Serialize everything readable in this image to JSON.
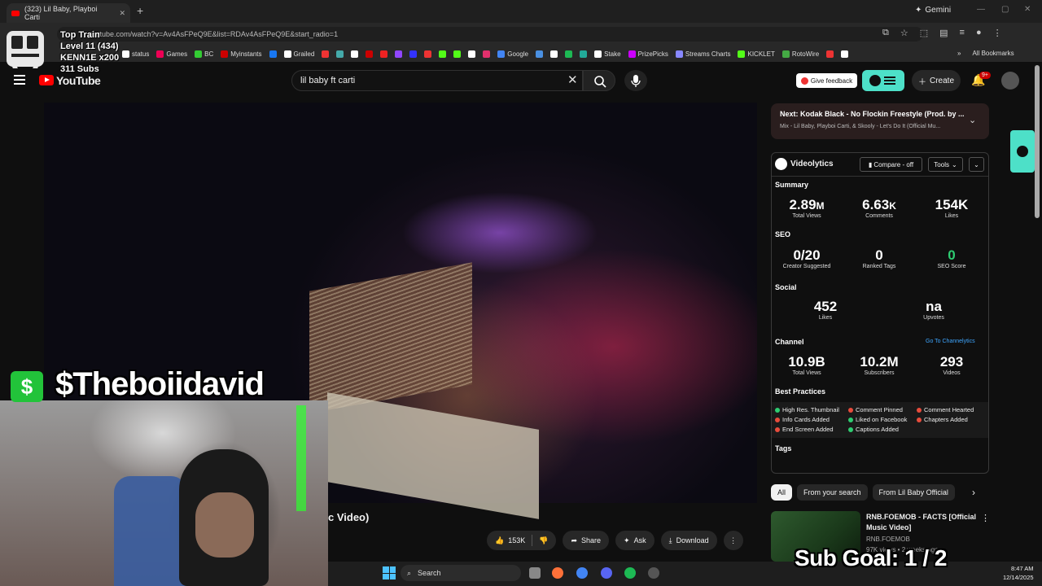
{
  "browser": {
    "tab_title": "(323) Lil Baby, Playboi Carti",
    "new_tab": "+",
    "tab_close": "✕",
    "gemini_label": "Gemini",
    "url": "youtube.com/watch?v=Av4AsFPeQ9E&list=RDAv4AsFPeQ9E&start_radio=1",
    "bookmarks": [
      {
        "label": "status",
        "color": "#ffffff"
      },
      {
        "label": "Games",
        "color": "#e05"
      },
      {
        "label": "BC",
        "color": "#3c3"
      },
      {
        "label": "Myinstants",
        "color": "#c00"
      },
      {
        "label": "",
        "color": "#1877f2"
      },
      {
        "label": "Grailed",
        "color": "#fff"
      },
      {
        "label": "",
        "color": "#e33"
      },
      {
        "label": "",
        "color": "#4aa"
      },
      {
        "label": "",
        "color": "#fff"
      },
      {
        "label": "",
        "color": "#c00"
      },
      {
        "label": "",
        "color": "#e22"
      },
      {
        "label": "",
        "color": "#9146ff"
      },
      {
        "label": "",
        "color": "#33f"
      },
      {
        "label": "",
        "color": "#e33"
      },
      {
        "label": "",
        "color": "#53fc18"
      },
      {
        "label": "",
        "color": "#53fc18"
      },
      {
        "label": "",
        "color": "#fff"
      },
      {
        "label": "",
        "color": "#e1306c"
      },
      {
        "label": "Google",
        "color": "#4285f4"
      },
      {
        "label": "",
        "color": "#4a90e2"
      },
      {
        "label": "",
        "color": "#fff"
      },
      {
        "label": "",
        "color": "#1db954"
      },
      {
        "label": "",
        "color": "#2a9"
      },
      {
        "label": "Stake",
        "color": "#fff"
      },
      {
        "label": "PrizePicks",
        "color": "#c0f"
      },
      {
        "label": "Streams Charts",
        "color": "#88f"
      },
      {
        "label": "KICKLET",
        "color": "#53fc18"
      },
      {
        "label": "RotoWire",
        "color": "#4a4"
      },
      {
        "label": "",
        "color": "#e33"
      },
      {
        "label": "",
        "color": "#fff"
      }
    ],
    "all_bookmarks": "All Bookmarks"
  },
  "overlay": {
    "train_title": "Top Train",
    "train_level": "Level 11  (434)",
    "train_user": "KENN1E x200",
    "train_subs": "311 Subs",
    "dollar_sign": "$",
    "handle": "$Theboiidavid",
    "sub_goal": "Sub Goal:  1 / 2"
  },
  "youtube": {
    "logo_text": "YouTube",
    "search_value": "lil baby ft carti",
    "feedback": "Give feedback",
    "create": "Create",
    "notif_count": "9+",
    "video_title_visible": "c Video)",
    "actions": {
      "likes": "153K",
      "share": "Share",
      "ask": "Ask",
      "download": "Download",
      "more": "⋮"
    },
    "next": {
      "title": "Next: Kodak Black - No Flockin Freestyle (Prod. by ...",
      "subtitle": "Mix - Lil Baby, Playboi Carti, & Skooly - Let's Do It (Official Mu..."
    },
    "chips": [
      "All",
      "From your search",
      "From Lil Baby Official"
    ],
    "recommendation": {
      "title": "RNB.FOEMOB - FACTS [Official Music Video]",
      "channel": "RNB.FOEMOB",
      "meta": "97K views • 2 weeks ago"
    }
  },
  "videolytics": {
    "title": "Videolytics",
    "compare": "Compare - off",
    "tools": "Tools",
    "summary_label": "Summary",
    "summary": [
      {
        "value": "2.89",
        "unit": "M",
        "label": "Total Views"
      },
      {
        "value": "6.63",
        "unit": "K",
        "label": "Comments"
      },
      {
        "value": "154K",
        "unit": "",
        "label": "Likes"
      }
    ],
    "seo_label": "SEO",
    "seo": [
      {
        "value": "0/20",
        "label": "Creator Suggested"
      },
      {
        "value": "0",
        "label": "Ranked Tags"
      },
      {
        "value": "0",
        "label": "SEO Score"
      }
    ],
    "social_label": "Social",
    "social": [
      {
        "value": "452",
        "label": "Likes"
      },
      {
        "value": "na",
        "label": "Upvotes"
      }
    ],
    "channel_label": "Channel",
    "channel_link": "Go To Channelytics",
    "channel": [
      {
        "value": "10.9B",
        "label": "Total Views"
      },
      {
        "value": "10.2M",
        "label": "Subscribers"
      },
      {
        "value": "293",
        "label": "Videos"
      }
    ],
    "best_practices_label": "Best Practices",
    "best_practices": [
      {
        "label": "High Res. Thumbnail",
        "color": "#2ecc71"
      },
      {
        "label": "Comment Pinned",
        "color": "#e74c3c"
      },
      {
        "label": "Comment Hearted",
        "color": "#e74c3c"
      },
      {
        "label": "Info Cards Added",
        "color": "#e74c3c"
      },
      {
        "label": "Liked on Facebook",
        "color": "#2ecc71"
      },
      {
        "label": "Chapters Added",
        "color": "#e74c3c"
      },
      {
        "label": "End Screen Added",
        "color": "#e74c3c"
      },
      {
        "label": "Captions Added",
        "color": "#2ecc71"
      }
    ],
    "tags_label": "Tags"
  },
  "taskbar": {
    "search": "Search",
    "time": "8:47 AM",
    "date": "12/14/2025"
  }
}
